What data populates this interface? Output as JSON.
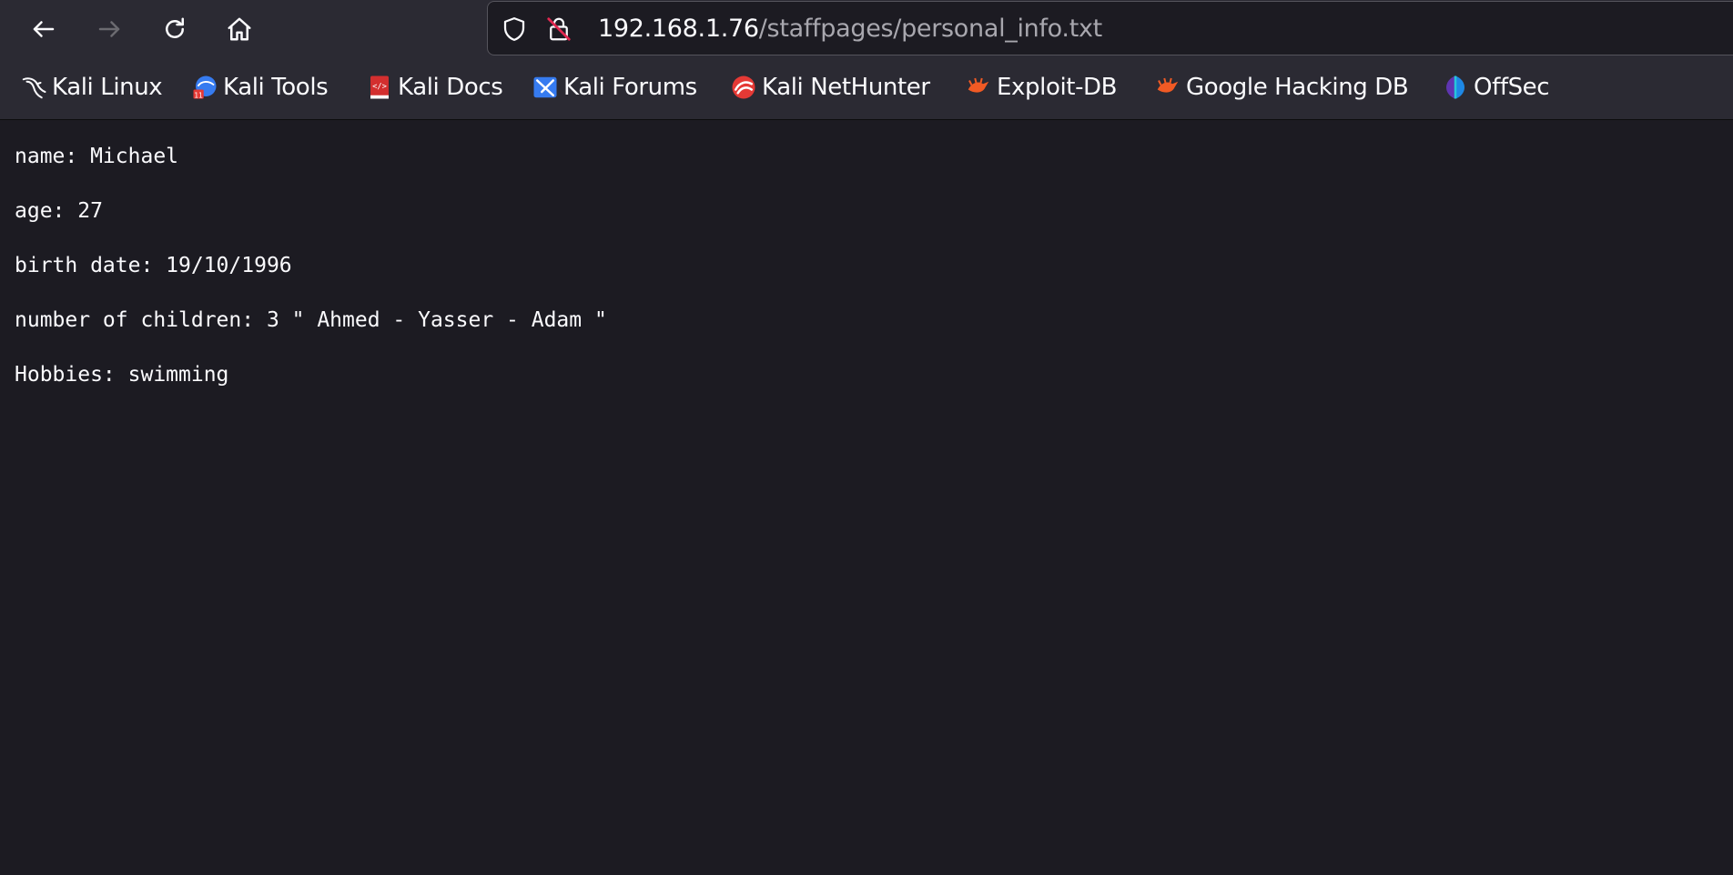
{
  "browser": {
    "nav": {
      "back_icon": "back-arrow-icon",
      "forward_icon": "forward-arrow-icon",
      "reload_icon": "reload-icon",
      "home_icon": "home-icon"
    },
    "urlbar": {
      "host": "192.168.1.76",
      "path": "/staffpages/personal_info.txt",
      "icons": [
        "shield-icon",
        "insecure-lock-icon"
      ]
    },
    "bookmarks": [
      {
        "label": "Kali Linux",
        "icon": "kali-dragon-icon"
      },
      {
        "label": "Kali Tools",
        "icon": "kali-tools-icon"
      },
      {
        "label": "Kali Docs",
        "icon": "kali-docs-icon"
      },
      {
        "label": "Kali Forums",
        "icon": "kali-forums-icon"
      },
      {
        "label": "Kali NetHunter",
        "icon": "kali-nethunter-icon"
      },
      {
        "label": "Exploit-DB",
        "icon": "exploit-db-icon"
      },
      {
        "label": "Google Hacking DB",
        "icon": "ghdb-icon"
      },
      {
        "label": "OffSec",
        "icon": "offsec-icon"
      }
    ]
  },
  "document": {
    "lines": [
      "name: Michael",
      "age: 27",
      "birth date: 19/10/1996",
      "number of children: 3 \" Ahmed - Yasser - Adam \"",
      "Hobbies: swimming"
    ]
  },
  "colors": {
    "toolbar_bg": "#2b2a33",
    "page_bg": "#1c1b22",
    "text": "#fbfbfe",
    "url_path": "#a8a7ae"
  }
}
